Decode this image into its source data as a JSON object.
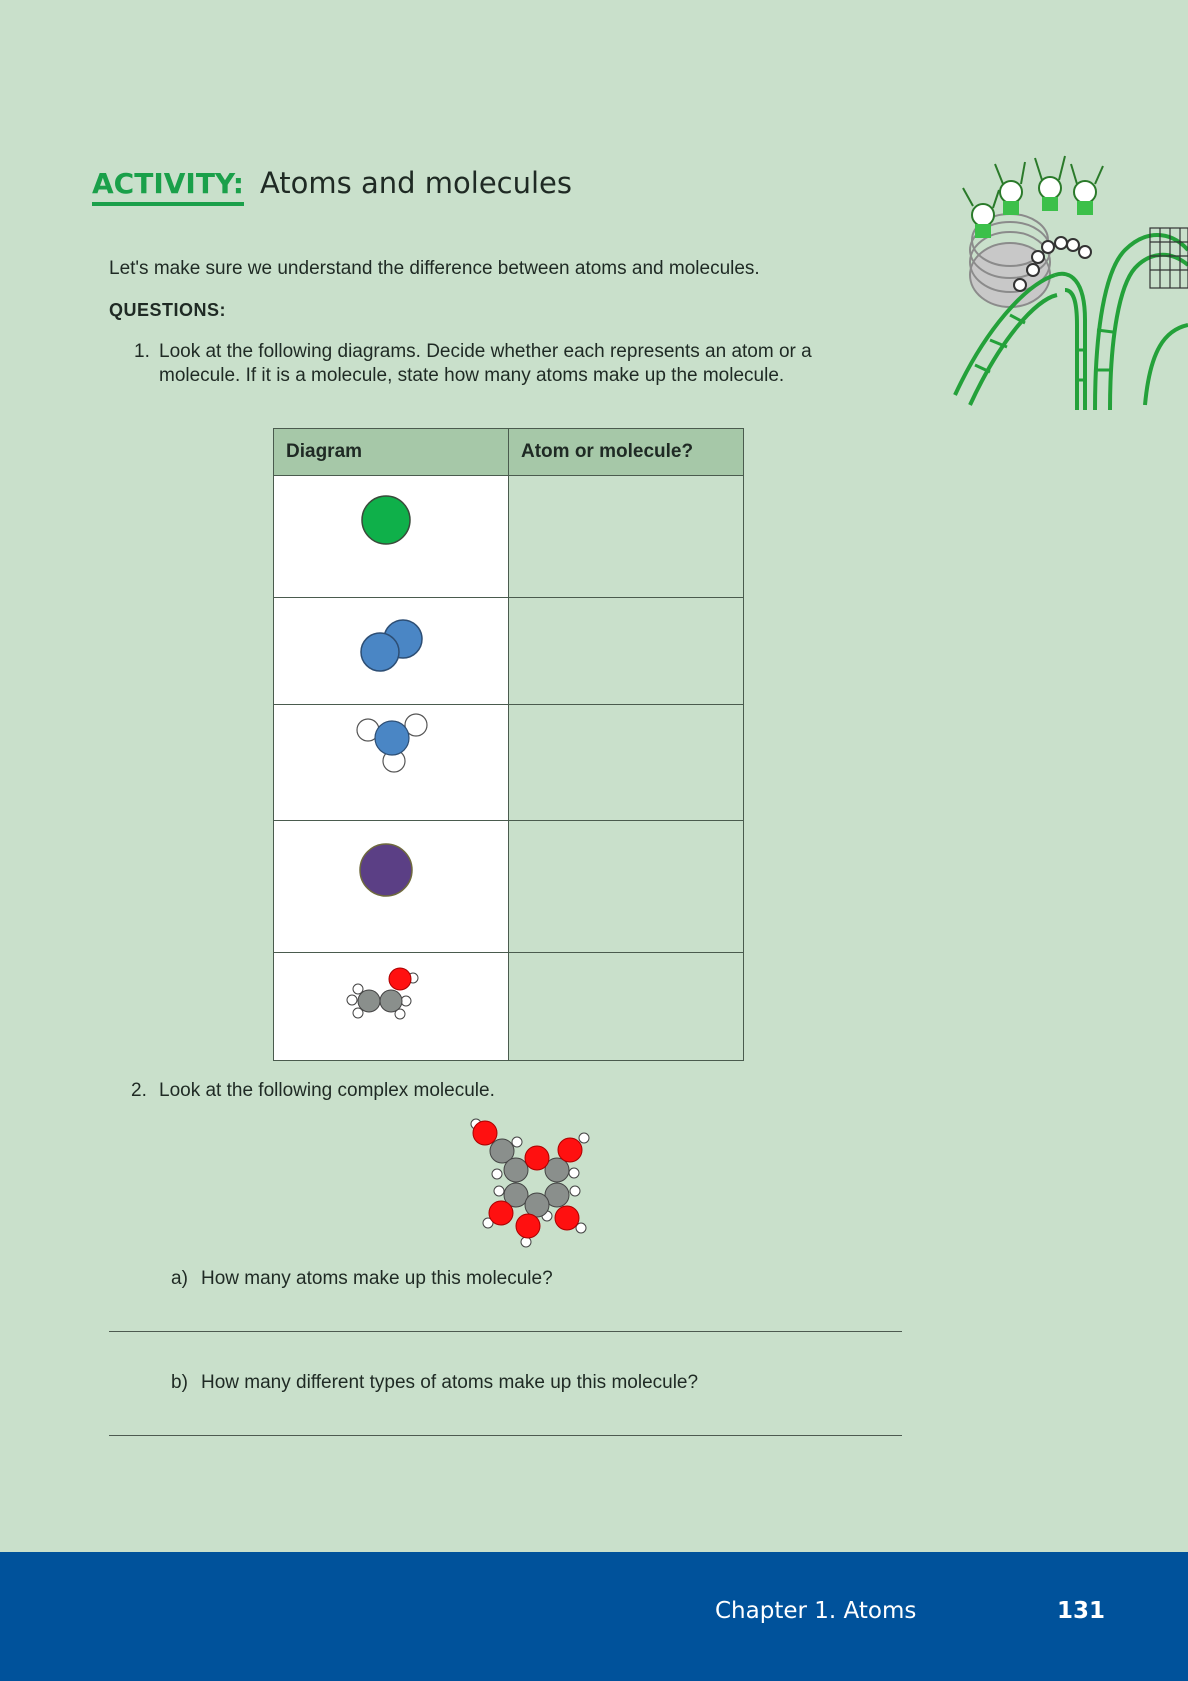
{
  "heading": {
    "label": "ACTIVITY:",
    "title": "Atoms and molecules"
  },
  "intro": "Let's make sure we understand the difference between atoms and molecules.",
  "questions_heading": "QUESTIONS:",
  "question1": {
    "number": "1.",
    "text": "Look at the following diagrams. Decide whether each represents an atom or a molecule. If it is a molecule, state how many atoms make up the molecule."
  },
  "table": {
    "headers": [
      "Diagram",
      "Atom or molecule?"
    ],
    "rows": [
      {
        "diagram": "green-atom",
        "answer": ""
      },
      {
        "diagram": "blue-diatomic-molecule",
        "answer": ""
      },
      {
        "diagram": "ammonia-like-molecule",
        "answer": ""
      },
      {
        "diagram": "purple-atom",
        "answer": ""
      },
      {
        "diagram": "ethanol-like-molecule",
        "answer": ""
      }
    ]
  },
  "question2": {
    "number": "2.",
    "text": "Look at the following complex molecule.",
    "a": {
      "label": "a)",
      "text": "How many atoms make up this molecule?"
    },
    "b": {
      "label": "b)",
      "text": "How many different types of atoms make up this molecule?"
    }
  },
  "colors": {
    "background": "#c9e0cb",
    "accent": "#1aa04a",
    "table_header": "#a6c8a8",
    "footer": "#00529b",
    "atom_green": "#0fb04a",
    "atom_blue": "#4a86c5",
    "atom_purple": "#5b3f85",
    "atom_red": "#ff1010",
    "atom_grey": "#8a8f8c"
  },
  "footer": {
    "chapter": "Chapter 1.   Atoms",
    "page": "131"
  }
}
